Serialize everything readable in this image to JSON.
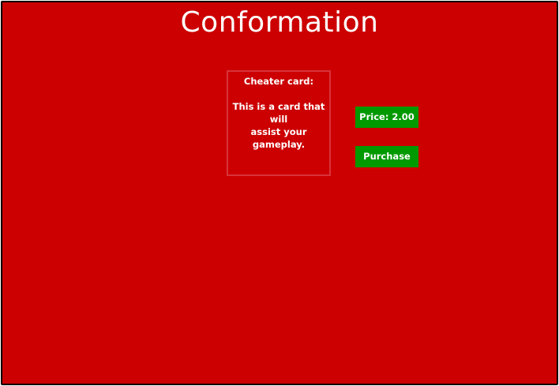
{
  "page": {
    "title": "Conformation"
  },
  "card": {
    "name": "Cheater card:",
    "description_lines": [
      "This is a card that",
      "will",
      "assist your",
      "gameplay."
    ]
  },
  "actions": {
    "price_label": "Price: 2.00",
    "purchase_label": "Purchase"
  },
  "colors": {
    "background": "#cc0000",
    "button": "#009900",
    "text": "#ffffff",
    "card_border": "#d8333a"
  }
}
